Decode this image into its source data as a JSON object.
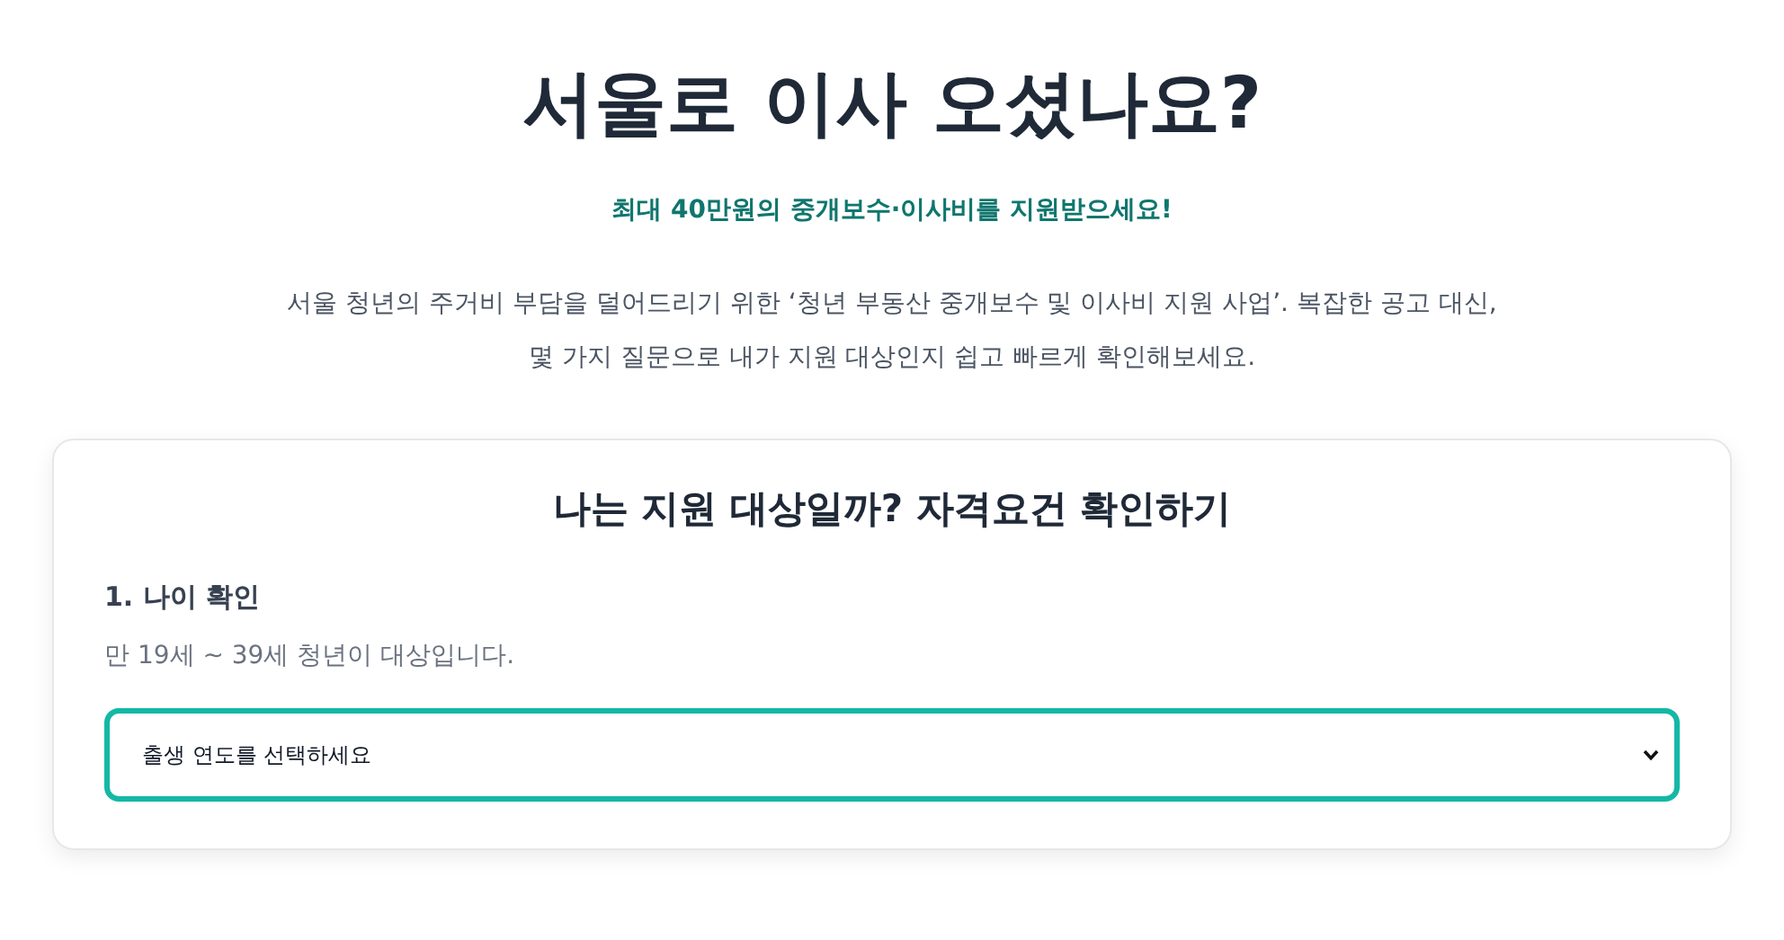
{
  "header": {
    "title": "서울로 이사 오셨나요?",
    "subtitle": "최대 40만원의 중개보수·이사비를 지원받으세요!",
    "description": [
      "서울 청년의 주거비 부담을 덜어드리기 위한 ‘청년 부동산 중개보수 및 이사비 지원 사업’. 복잡한 공고 대신,",
      "몇 가지 질문으로 내가 지원 대상인지 쉽고 빠르게 확인해보세요."
    ]
  },
  "card": {
    "title": "나는 지원 대상일까? 자격요건 확인하기",
    "step": {
      "label": "1. 나이 확인",
      "hint": "만 19세 ~ 39세 청년이 대상입니다.",
      "select": {
        "placeholder": "출생 연도를 선택하세요",
        "focused": true
      }
    }
  }
}
